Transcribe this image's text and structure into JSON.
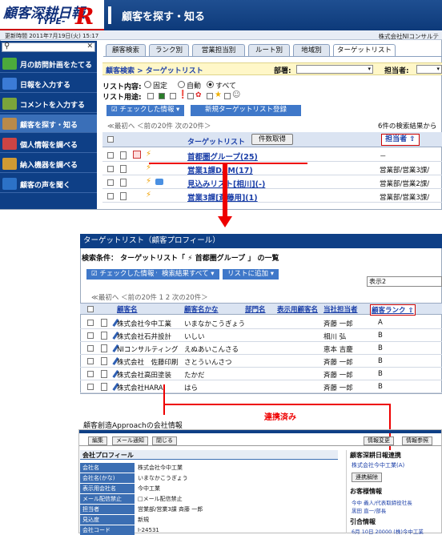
{
  "app": {
    "logo_text": "顧客深耕日報",
    "logo_sub": "TYPE-",
    "logo_r": "R",
    "page_title": "顧客を探す・知る",
    "updated": "更新時間 2011年7月19日(火) 15:17",
    "company": "株式会社NIコンサルテ"
  },
  "sidebar": {
    "items": [
      {
        "label": "月の訪問計画をたてる",
        "color": "#4caa3c"
      },
      {
        "label": "日報を入力する",
        "color": "#3b7bd6"
      },
      {
        "label": "コメントを入力する",
        "color": "#7aa53b"
      },
      {
        "label": "顧客を探す・知る",
        "color": "#b98a4a"
      },
      {
        "label": "個人情報を調べる",
        "color": "#c44"
      },
      {
        "label": "納入機器を調べる",
        "color": "#d09a33"
      },
      {
        "label": "顧客の声を聞く",
        "color": "#2c72c7"
      }
    ]
  },
  "tabs": [
    "顧客検索",
    "ランク別",
    "営業担当別",
    "ルート別",
    "地域別",
    "ターゲットリスト"
  ],
  "crumb": {
    "label": "顧客検索 > ターゲットリスト",
    "dept_label": "部署:",
    "owner_label": "担当者:"
  },
  "filters": {
    "content_label": "リスト内容:",
    "content_options": [
      "固定",
      "自動",
      "すべて"
    ],
    "use_label": "リスト用途:"
  },
  "actions": {
    "checked_info": "☑ チェックした情報 ▾",
    "new_target": "新規ターゲットリスト登録"
  },
  "paging": {
    "text": "≪最初へ  ＜前の20件  次の20件＞",
    "result": "6件の検索結果から"
  },
  "table": {
    "col_target": "ターゲットリスト",
    "count_btn": "件数取得",
    "col_owner": "担当者 ⇧",
    "rows": [
      {
        "name": "首都圏グループ(25)",
        "owner": "－"
      },
      {
        "name": "営業1課DAM(17)",
        "owner": "営業部/営業3課/"
      },
      {
        "name": "見込みリスト[相川](-)",
        "owner": "営業部/営業2課/"
      },
      {
        "name": "営業3課[斎藤用](1)",
        "owner": "営業部/営業3課/"
      }
    ]
  },
  "win2": {
    "title": "ターゲットリスト（顧客プロフィール）",
    "cond": "検索条件： ターゲットリスト「 ⚡ 首都圏グループ 」 の一覧",
    "btn1": "☑ チェックした情報 ▾",
    "btn2": "検索結果すべて ▾",
    "btn3": "リストに追加 ▾",
    "display": "表示2",
    "paging": "≪最初へ  ＜前の20件  1  2  次の20件＞",
    "cols": [
      "顧客名",
      "顧客名かな",
      "部門名",
      "表示用顧客名",
      "当社担当者",
      "顧客ランク ⇧"
    ],
    "rows": [
      [
        "株式会社今中工業",
        "いまなかこうぎょう",
        "",
        "",
        "斉藤 一郎",
        "A"
      ],
      [
        "株式会社石井設計",
        "いしい",
        "",
        "",
        "相川 弘",
        "B"
      ],
      [
        "NIコンサルティング",
        "えぬあいこんさる",
        "",
        "",
        "恵本 吉慶",
        "B"
      ],
      [
        "株式会社　佐藤印刷",
        "さとういんさつ",
        "",
        "",
        "斉藤 一郎",
        "B"
      ],
      [
        "株式会社高田塗装",
        "たかだ",
        "",
        "",
        "斉藤 一郎",
        "B"
      ],
      [
        "株式会社HARA",
        "はら",
        "",
        "",
        "斉藤 一郎",
        "B"
      ]
    ]
  },
  "connect": {
    "label": "連携済み"
  },
  "win3": {
    "caption": "顧客創造Approachの会社情報",
    "btns": [
      "編集",
      "メール通知",
      "閉じる"
    ],
    "rbtns": [
      "情報変更",
      "情報参照"
    ],
    "profile_title": "会社プロフィール",
    "profile": [
      [
        "会社名",
        "株式会社今中工業"
      ],
      [
        "会社名(かな)",
        "いまなかこうぎょう"
      ],
      [
        "表示用会社名",
        "今中工業"
      ],
      [
        "メール配信禁止",
        "□メール配信禁止"
      ],
      [
        "担当者",
        "営業部/営業3課 斉藤 一郎"
      ],
      [
        "見込度",
        "新規"
      ],
      [
        "会社コード",
        "I-24531"
      ]
    ],
    "right_title": "顧客深耕日報連携",
    "right_link": "株式会社今中工業(A)",
    "right_btn": "連携解除",
    "info_title": "お客様情報",
    "info_items": [
      "今中 義人/代表取締役社長",
      "黒田 直一/部長"
    ],
    "info2_title": "引合情報",
    "info2_item": "6月 10日 20000 (株)今中工業"
  }
}
